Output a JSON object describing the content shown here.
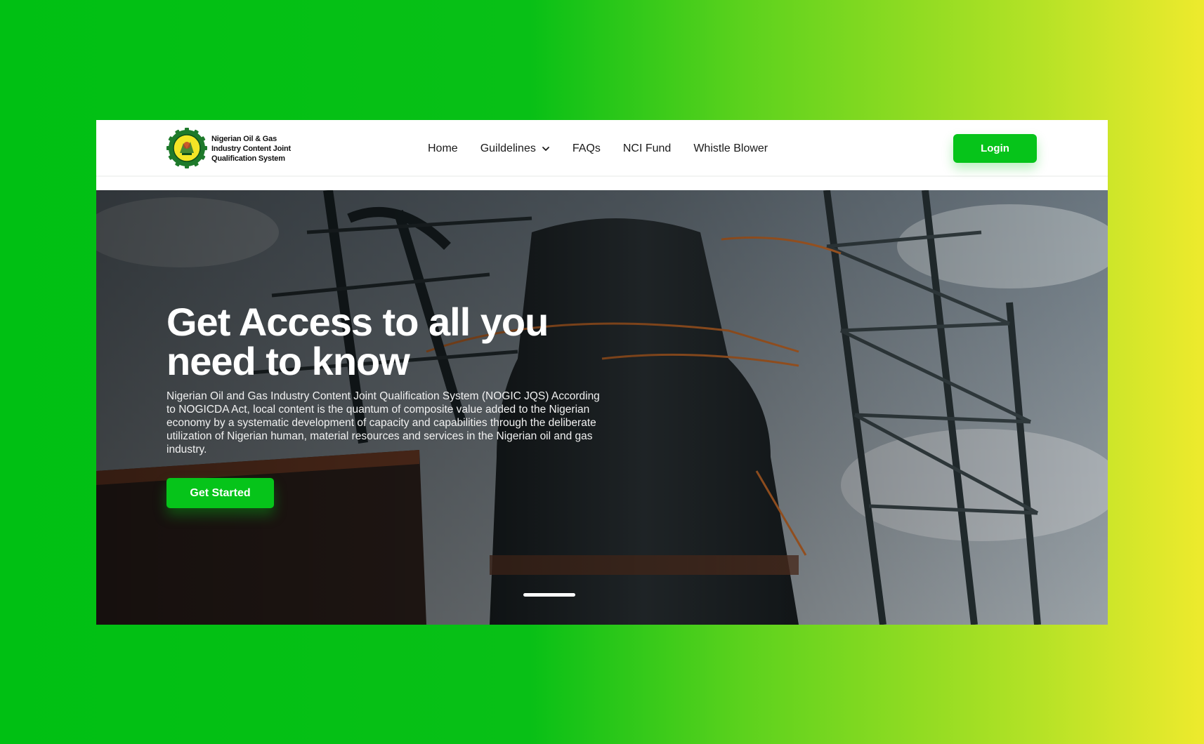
{
  "brand": {
    "name_lines": [
      "Nigerian Oil & Gas",
      "Industry Content Joint",
      "Qualification System"
    ],
    "logo_icon": "nogic-jqs-gear-logo-icon",
    "accent_color": "#06c41a"
  },
  "nav": {
    "items": [
      {
        "label": "Home"
      },
      {
        "label": "Guildelines",
        "has_dropdown": true,
        "icon": "chevron-down-icon"
      },
      {
        "label": "FAQs"
      },
      {
        "label": "NCI Fund"
      },
      {
        "label": "Whistle Blower"
      }
    ],
    "login_label": "Login"
  },
  "hero": {
    "title": "Get Access to all you need to know",
    "description": "Nigerian Oil and Gas Industry Content Joint Qualification System (NOGIC JQS) According to NOGICDA Act, local content is the quantum of composite value added to the Nigerian economy by a systematic development of capacity and capabilities through the deliberate utilization of Nigerian human, material resources and services in the Nigerian oil and gas industry.",
    "cta_label": "Get Started",
    "background_image": "industrial-plant-tower-photo",
    "carousel": {
      "slide_count": 1,
      "active_slide": 1
    }
  },
  "background": {
    "gradient_start": "#00c013",
    "gradient_end": "#eeea2d"
  }
}
